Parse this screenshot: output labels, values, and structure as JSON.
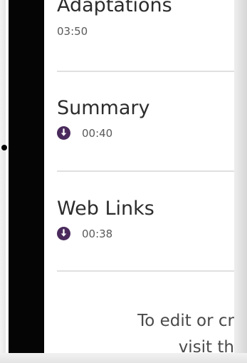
{
  "sessions": [
    {
      "title": "Adaptations",
      "duration": "03:50",
      "downloadable": false
    },
    {
      "title": "Summary",
      "duration": "00:40",
      "downloadable": true,
      "icon": "download-icon"
    },
    {
      "title": "Web Links",
      "duration": "00:38",
      "downloadable": true,
      "icon": "download-icon"
    }
  ],
  "footer": {
    "line1": "To edit or cr",
    "line2": "visit th"
  },
  "colors": {
    "accent": "#4a2a5c",
    "text": "#2c2c2c",
    "divider": "#e0e0e0"
  }
}
